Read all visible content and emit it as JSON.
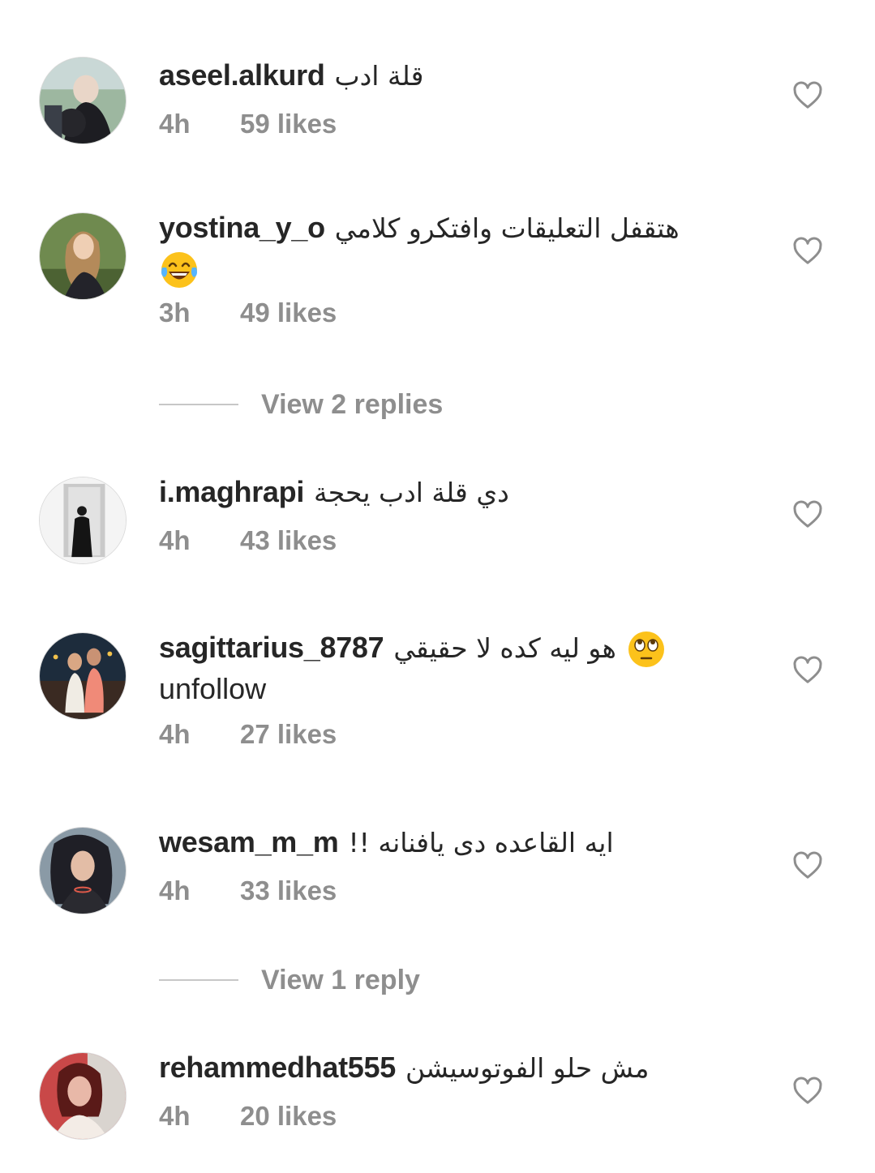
{
  "comments": [
    {
      "username": "aseel.alkurd",
      "text": "قلة ادب",
      "time": "4h",
      "likes": "59 likes"
    },
    {
      "username": "yostina_y_o",
      "text": "هتقفل التعليقات وافتكرو كلامي",
      "line2_emoji": "tears-of-joy-emoji",
      "time": "3h",
      "likes": "49 likes"
    },
    {
      "username": "i.maghrapi",
      "text": "دي قلة ادب يحجة",
      "time": "4h",
      "likes": "43 likes"
    },
    {
      "username": "sagittarius_8787",
      "text": "هو ليه كده لا حقيقي",
      "text_emoji": "rolling-eyes-emoji",
      "line2": "unfollow",
      "time": "4h",
      "likes": "27 likes"
    },
    {
      "username": "wesam_m_m",
      "text": "ايه القاعده دى يافنانه !!",
      "time": "4h",
      "likes": "33 likes"
    },
    {
      "username": "rehammedhat555",
      "text": "مش حلو الفوتوسيشن",
      "time": "4h",
      "likes": "20 likes"
    }
  ],
  "replies": [
    {
      "label": "View 2 replies"
    },
    {
      "label": "View 1 reply"
    }
  ],
  "icons": {
    "like": "heart-outline-icon"
  },
  "colors": {
    "text": "#262626",
    "secondary": "#8e8e8e",
    "divider": "#c7c7c7"
  }
}
